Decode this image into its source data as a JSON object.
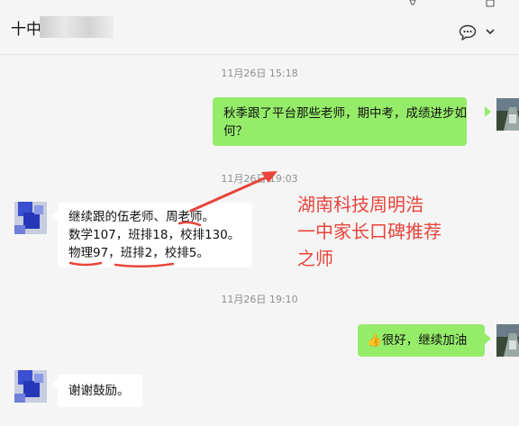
{
  "header": {
    "title": "十中"
  },
  "messages": [
    {
      "timestamp": "11月26日 15:18"
    },
    {
      "lines": [
        "秋季跟了平台那些老师，期中考，成绩进步如",
        "何？"
      ]
    },
    {
      "timestamp": "11月26日 19:03"
    },
    {
      "lines": [
        "继续跟的伍老师、周老师。",
        "数学107，班排18，校排130。",
        "物理97，班排2，校排5。"
      ]
    },
    {
      "timestamp": "11月26日 19:10"
    },
    {
      "emoji": "👍",
      "text": "很好，继续加油"
    },
    {
      "text": "谢谢鼓励。"
    }
  ],
  "annotation": {
    "lines": [
      "湖南科技周明浩",
      "一中家长口碑推荐",
      "之师"
    ]
  },
  "colors": {
    "my_bubble": "#95ec69",
    "their_bubble": "#ffffff",
    "annotation": "#e8453c",
    "background": "#f5f5f5"
  },
  "icons": [
    "pin-icon",
    "minimize-icon",
    "chat-bubble-icon",
    "chevron-down-icon"
  ]
}
